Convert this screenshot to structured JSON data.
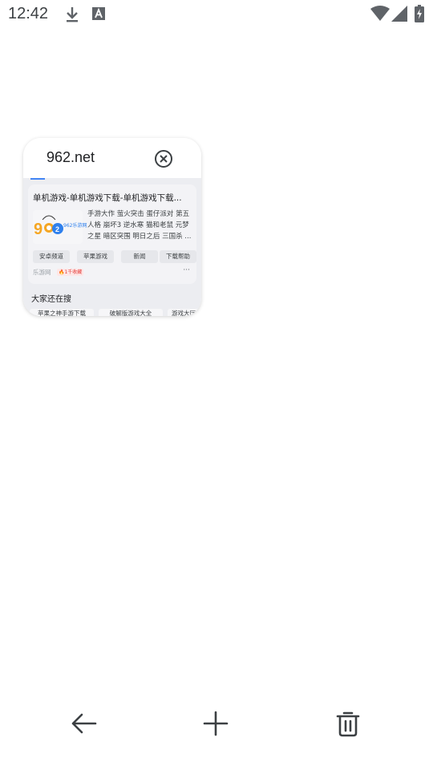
{
  "status_bar": {
    "time": "12:42",
    "icons": [
      "download-icon",
      "a-notification-icon",
      "wifi-icon",
      "cell-signal-icon",
      "battery-charging-icon"
    ]
  },
  "tab": {
    "title": "962.net",
    "close_icon": "close-circle-icon",
    "preview": {
      "result_title": "单机游戏-单机游戏下载-单机游戏下载...",
      "logo_text": "962乐游网",
      "snippet": "手游大作 萤火突击 蛋仔派对 第五人格 崩坏3 逆水寒 猫和老鼠 元梦之星 暗区突围 明日之后 三国杀 ...",
      "site_links": [
        "安卓频道",
        "苹果游戏",
        "新闻",
        "下载帮助"
      ],
      "source": "乐游网",
      "hot_badge": "🔥1千收藏",
      "more": "···",
      "related_title": "大家还在搜",
      "related_chips": [
        "苹果之神手游下载",
        "破解版游戏大全",
        "游戏大厅"
      ]
    }
  },
  "bottom_bar": {
    "icons": [
      "back-arrow-icon",
      "plus-icon",
      "trash-icon"
    ]
  },
  "colors": {
    "accent": "#4285f4",
    "preview_bg": "#ecedf1",
    "icon": "#3c4043"
  }
}
